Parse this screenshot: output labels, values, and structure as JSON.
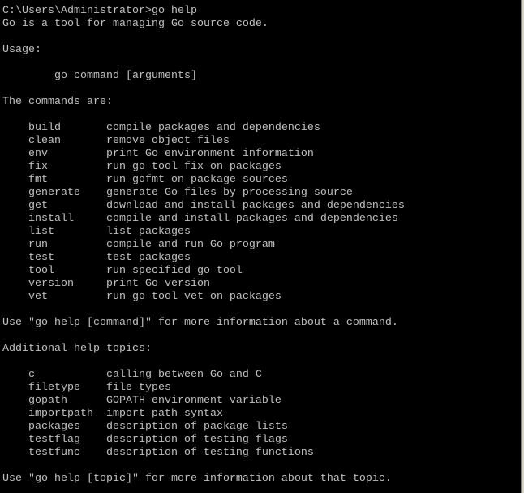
{
  "colors": {
    "background": "#000000",
    "text": "#c0c0c0"
  },
  "lines": [
    "C:\\Users\\Administrator>go help",
    "Go is a tool for managing Go source code.",
    "",
    "Usage:",
    "",
    "        go command [arguments]",
    "",
    "The commands are:",
    "",
    "    build       compile packages and dependencies",
    "    clean       remove object files",
    "    env         print Go environment information",
    "    fix         run go tool fix on packages",
    "    fmt         run gofmt on package sources",
    "    generate    generate Go files by processing source",
    "    get         download and install packages and dependencies",
    "    install     compile and install packages and dependencies",
    "    list        list packages",
    "    run         compile and run Go program",
    "    test        test packages",
    "    tool        run specified go tool",
    "    version     print Go version",
    "    vet         run go tool vet on packages",
    "",
    "Use \"go help [command]\" for more information about a command.",
    "",
    "Additional help topics:",
    "",
    "    c           calling between Go and C",
    "    filetype    file types",
    "    gopath      GOPATH environment variable",
    "    importpath  import path syntax",
    "    packages    description of package lists",
    "    testflag    description of testing flags",
    "    testfunc    description of testing functions",
    "",
    "Use \"go help [topic]\" for more information about that topic."
  ]
}
